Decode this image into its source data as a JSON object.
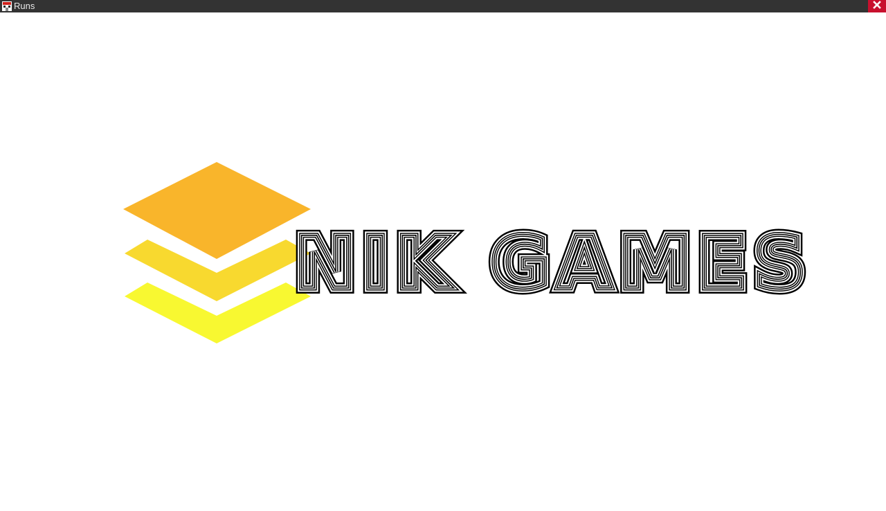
{
  "window": {
    "title": "Runs",
    "app_icon": "game-app-icon",
    "close_icon": "close-x-icon"
  },
  "splash": {
    "logo_mark_icon": "stacked-layers-icon",
    "brand_text": "NIK GAMES",
    "colors": {
      "layer_top": "#F9B52B",
      "layer_middle": "#F8D92F",
      "layer_bottom": "#F8F831",
      "wordmark": "#000000",
      "titlebar": "#333333",
      "close_button": "#C8102E"
    }
  }
}
